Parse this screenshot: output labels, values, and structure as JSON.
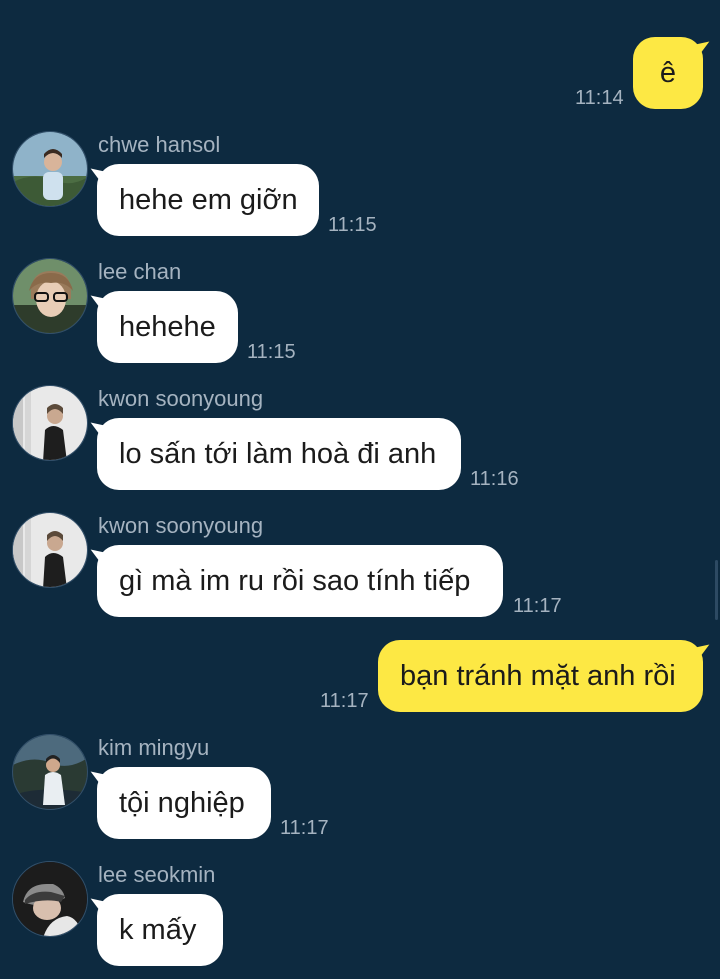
{
  "messages": [
    {
      "type": "out",
      "text": "ê",
      "time": "11:14"
    },
    {
      "type": "in",
      "sender": "chwe hansol",
      "text": "hehe em giỡn",
      "time": "11:15",
      "avatar": "avatar-hansol"
    },
    {
      "type": "in",
      "sender": "lee chan",
      "text": "hehehe",
      "time": "11:15",
      "avatar": "avatar-chan"
    },
    {
      "type": "in",
      "sender": "kwon soonyoung",
      "text": "lo sấn tới làm hoà đi anh",
      "time": "11:16",
      "avatar": "avatar-soonyoung"
    },
    {
      "type": "in",
      "sender": "kwon soonyoung",
      "text": "gì mà im ru rồi sao tính tiếp",
      "time": "11:17",
      "avatar": "avatar-soonyoung"
    },
    {
      "type": "out",
      "text": "bạn tránh mặt anh rồi",
      "time": "11:17"
    },
    {
      "type": "in",
      "sender": "kim mingyu",
      "text": "tội nghiệp",
      "time": "11:17",
      "avatar": "avatar-mingyu"
    },
    {
      "type": "in",
      "sender": "lee seokmin",
      "text": "k mấy",
      "time": "",
      "avatar": "avatar-seokmin"
    }
  ],
  "colors": {
    "background": "#0d2a40",
    "outgoing_bubble": "#fde844",
    "incoming_bubble": "#ffffff",
    "meta_text": "#a5b3c0"
  }
}
